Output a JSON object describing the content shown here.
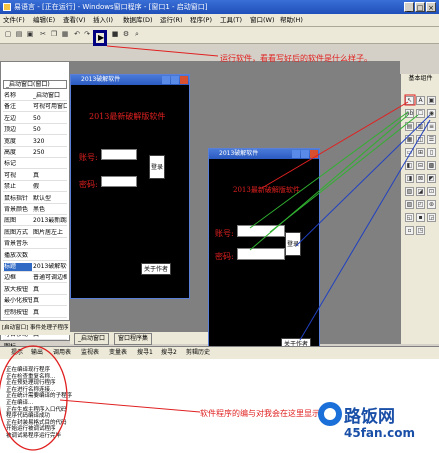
{
  "window": {
    "title": "易语言 - [正在运行] - Windows窗口程序 - [窗口1 - 启动窗口]",
    "min": "_",
    "max": "□",
    "close": "×"
  },
  "menu": [
    "文件(F)",
    "编辑(E)",
    "查看(V)",
    "插入(I)",
    "数据库(D)",
    "运行(R)",
    "程序(P)",
    "工具(T)",
    "窗口(W)",
    "帮助(H)"
  ],
  "toolbar": {
    "icons": [
      "new-icon",
      "open-icon",
      "save-icon",
      "cut-icon",
      "copy-icon",
      "paste-icon",
      "undo-icon",
      "redo-icon",
      "find-icon",
      "run-icon",
      "stop-icon",
      "compile-icon"
    ],
    "run_label": "▶"
  },
  "properties": {
    "combo": "_启动窗口(窗口)",
    "rows": [
      [
        "名称",
        "_启动窗口"
      ],
      [
        "备注",
        "可视可用窗口"
      ],
      [
        "左边",
        "50"
      ],
      [
        "顶边",
        "50"
      ],
      [
        "宽度",
        "320"
      ],
      [
        "高度",
        "250"
      ],
      [
        "标记",
        ""
      ],
      [
        "可视",
        "真"
      ],
      [
        "禁止",
        "假"
      ],
      [
        "鼠标指针",
        "默认型"
      ],
      [
        "背景颜色",
        "黑色"
      ],
      [
        "底图",
        "2013最新跳跳"
      ],
      [
        "底图方式",
        "图片居左上"
      ],
      [
        "背景音乐",
        ""
      ],
      [
        "播放次数",
        ""
      ],
      [
        "标题",
        "2013破解软件"
      ],
      [
        "边框",
        "普通可调边框"
      ],
      [
        "放大按钮",
        "真"
      ],
      [
        "最小化按钮",
        "真"
      ],
      [
        "控制按钮",
        "真"
      ],
      [
        "位置",
        "通常"
      ],
      [
        "可否移动",
        "真"
      ],
      [
        "图标",
        ""
      ],
      [
        "回车下移焦点",
        "假"
      ],
      [
        "Esc键关闭",
        "真"
      ]
    ],
    "selected_index": 15,
    "bottom_label": "[启动窗口] 事件处理子程序"
  },
  "design_tabs": [
    "_启动窗口",
    "窗口程序集"
  ],
  "form1": {
    "title": "2013破解软件",
    "heading": "2013最新破解版软件",
    "account_label": "账号:",
    "password_label": "密码:",
    "login_button": "登录",
    "about_button": "关于作者"
  },
  "form2": {
    "title": "2013破解软件",
    "heading": "2013最新破解版软件",
    "account_label": "账号:",
    "password_label": "密码:",
    "login_button": "登录",
    "about_button": "关于作者"
  },
  "toolbox": {
    "title": "基本组件",
    "tools": [
      "↖",
      "A",
      "▣",
      "ab",
      "☐",
      "◉",
      "▤",
      "▥",
      "≡",
      "▦",
      "◫",
      "☰",
      "▭",
      "⊞",
      "▯",
      "◧",
      "⊟",
      "▩",
      "◨",
      "⊠",
      "◩",
      "▧",
      "◪",
      "⊡",
      "▨",
      "◰",
      "⊛",
      "◱",
      "▪",
      "◲",
      "▫",
      "◳"
    ]
  },
  "bottom_tabs": [
    "提示",
    "输出",
    "调用表",
    "监视表",
    "变量表",
    "搜寻1",
    "搜寻2",
    "剪辑历史"
  ],
  "output_lines": [
    "正在编译现行程序",
    "正在检查重复名称...",
    "正在预处理现行程序",
    "正在进行名称连接...",
    "正在统计需要编译的子程序",
    "正在编译...",
    "正在生成主程序入口代码",
    "程序代码编译成功",
    "正在封装易格式目的代码",
    "开始运行被调试程序",
    "被调试易程序运行完毕"
  ],
  "annotations": {
    "run_note": "运行软件，看看写好后的软件是什么样子。",
    "output_note": "软件程序的编与对我会在这里显示出来。"
  },
  "watermark": {
    "title": "路饭网",
    "url": "45fan.com"
  }
}
